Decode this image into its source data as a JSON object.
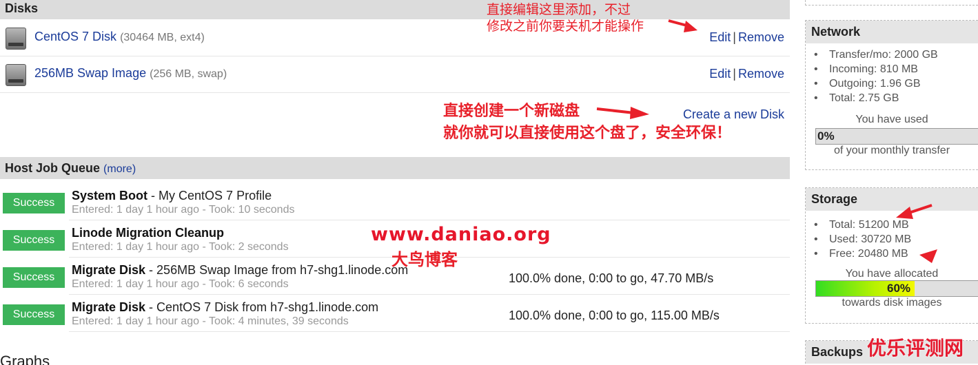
{
  "disks": {
    "header": "Disks",
    "items": [
      {
        "name": "CentOS 7 Disk",
        "meta": "(30464 MB, ext4)",
        "edit": "Edit",
        "sep": "|",
        "remove": "Remove"
      },
      {
        "name": "256MB Swap Image",
        "meta": "(256 MB, swap)",
        "edit": "Edit",
        "sep": "|",
        "remove": "Remove"
      }
    ],
    "create_link": "Create a new Disk"
  },
  "job_queue": {
    "header": "Host Job Queue",
    "more": "(more)",
    "jobs": [
      {
        "status": "Success",
        "title": "System Boot",
        "detail": " - My CentOS 7 Profile",
        "sub": "Entered: 1 day 1 hour ago - Took: 10 seconds",
        "progress": ""
      },
      {
        "status": "Success",
        "title": "Linode Migration Cleanup",
        "detail": "",
        "sub": "Entered: 1 day 1 hour ago - Took: 2 seconds",
        "progress": ""
      },
      {
        "status": "Success",
        "title": "Migrate Disk",
        "detail": " - 256MB Swap Image from h7-shg1.linode.com",
        "sub": "Entered: 1 day 1 hour ago - Took: 6 seconds",
        "progress": "100.0% done, 0:00 to go, 47.70 MB/s"
      },
      {
        "status": "Success",
        "title": "Migrate Disk",
        "detail": " - CentOS 7 Disk from h7-shg1.linode.com",
        "sub": "Entered: 1 day 1 hour ago - Took: 4 minutes, 39 seconds",
        "progress": "100.0% done, 0:00 to go, 115.00 MB/s"
      }
    ]
  },
  "graphs_heading": "Graphs",
  "network": {
    "title": "Network",
    "items": [
      "Transfer/mo: 2000 GB",
      "Incoming: 810 MB",
      "Outgoing: 1.96 GB",
      "Total: 2.75 GB"
    ],
    "used_caption": "You have used",
    "bar_value": 0,
    "bar_label": "0%",
    "bar_caption": "of your monthly transfer"
  },
  "storage": {
    "title": "Storage",
    "items": [
      "Total: 51200 MB",
      "Used: 30720 MB",
      "Free: 20480 MB"
    ],
    "alloc_caption": "You have allocated",
    "bar_value": 60,
    "bar_label": "60%",
    "bar_caption": "towards disk images"
  },
  "backups": {
    "title": "Backups"
  },
  "annotations": {
    "edit_note_line1": "直接编辑这里添加，不过",
    "edit_note_line2": "修改之前你要关机才能操作",
    "create_note_line1": "直接创建一个新磁盘",
    "create_note_line2": "就你就可以直接使用这个盘了，安全环保！",
    "watermark_url": "www.daniao.org",
    "watermark_name": "大鸟博客",
    "corner_watermark": "优乐评测网"
  },
  "colors": {
    "accent_link": "#1a3b99",
    "success": "#3cb35a",
    "annotation_red": "#e8202a"
  }
}
